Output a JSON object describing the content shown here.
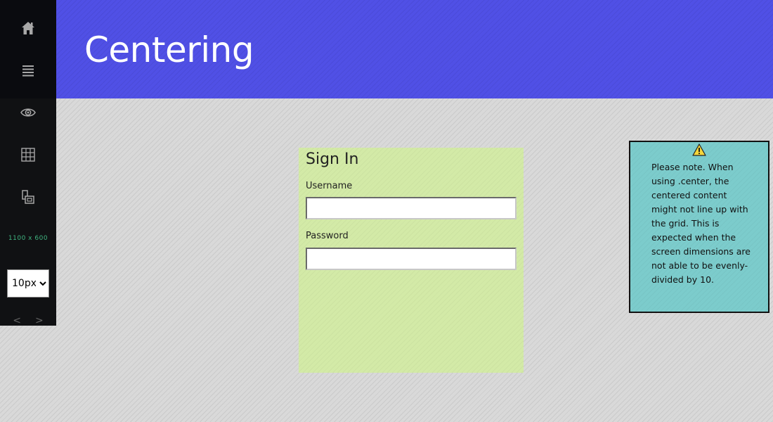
{
  "toolbar": {
    "buttons": [
      "home",
      "menu",
      "view",
      "grid",
      "layout"
    ],
    "dimensions_label": "1100 x 600",
    "grid_size": {
      "selected": "10px",
      "options": [
        "10px"
      ]
    },
    "prev_label": "<",
    "next_label": ">",
    "icons": {
      "home": "home-icon",
      "menu": "hamburger-menu-icon",
      "view": "eye-icon",
      "grid": "grid-icon",
      "layout": "layout-icon"
    }
  },
  "header": {
    "title": "Centering",
    "background_color": "#5050e6"
  },
  "signin": {
    "title": "Sign In",
    "username_label": "Username",
    "username_value": "",
    "password_label": "Password",
    "password_value": "",
    "background_color": "#d3eaa7"
  },
  "note": {
    "icon": "warning-icon",
    "text": "Please note. When using .center, the centered content might not line up with the grid. This is expected when the screen dimensions are not able to be evenly-divided by 10.",
    "background_color": "#7ccccc"
  }
}
